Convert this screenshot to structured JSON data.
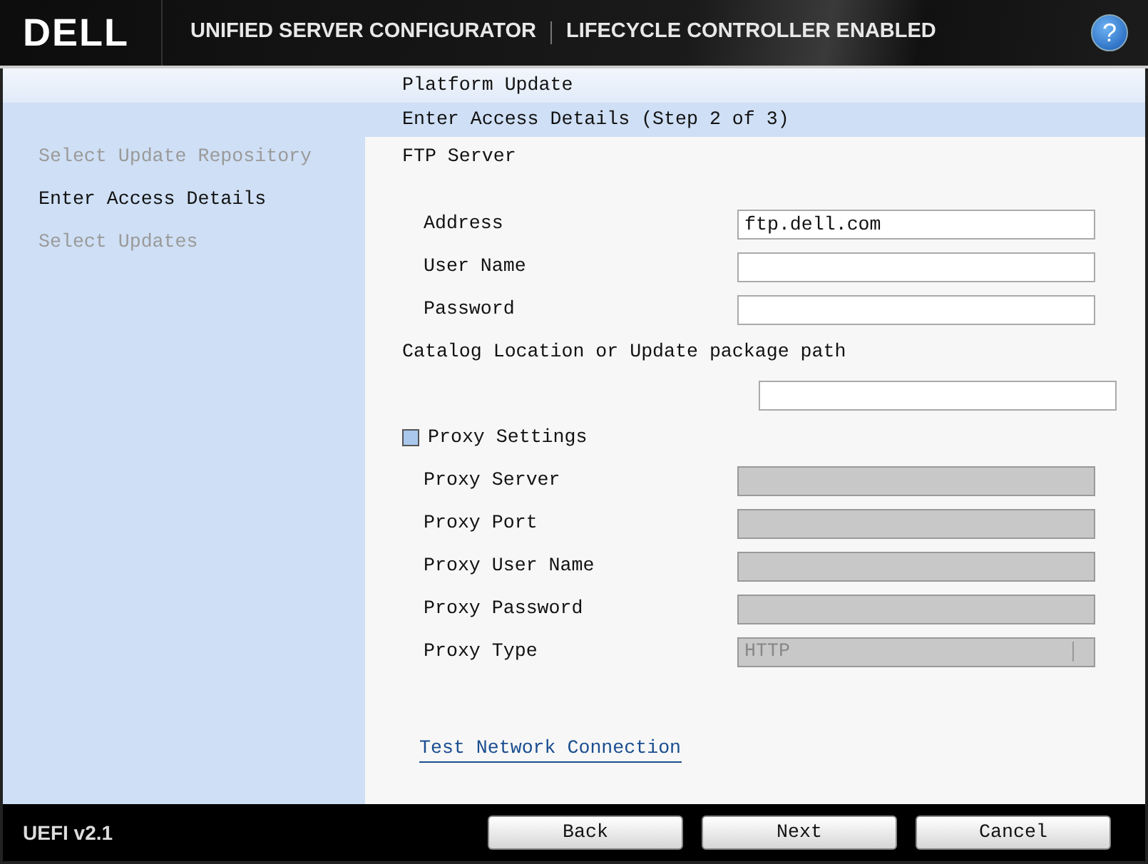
{
  "header": {
    "logo": "DELL",
    "title": "UNIFIED SERVER CONFIGURATOR",
    "subtitle": "LIFECYCLE CONTROLLER ENABLED",
    "help": "?"
  },
  "page_title": "Platform Update",
  "step_title": "Enter Access Details (Step 2 of 3)",
  "steps": [
    {
      "label": "Select Update Repository",
      "selected": false
    },
    {
      "label": "Enter Access Details",
      "selected": true
    },
    {
      "label": "Select Updates",
      "selected": false
    }
  ],
  "ftp_section": "FTP Server",
  "ftp_fields": [
    {
      "label": "Address",
      "value": "ftp.dell.com",
      "disabled": false
    },
    {
      "label": "User Name",
      "disabled": false
    },
    {
      "label": "Password",
      "disabled": false
    }
  ],
  "catalog": {
    "label": "Catalog Location or Update package path",
    "disabled": false
  },
  "proxy": {
    "label": "Proxy Settings",
    "checked": false
  },
  "proxy_fields": [
    {
      "label": "Proxy Server",
      "kind": "text",
      "disabled": true
    },
    {
      "label": "Proxy Port",
      "kind": "text",
      "disabled": true
    },
    {
      "label": "Proxy User Name",
      "kind": "text",
      "disabled": true
    },
    {
      "label": "Proxy Password",
      "kind": "text",
      "disabled": true
    },
    {
      "label": "Proxy Type",
      "kind": "select",
      "value": "HTTP",
      "disabled": true
    }
  ],
  "test_link": "Test Network Connection",
  "footer": {
    "version": "UEFI v2.1",
    "buttons": [
      "Back",
      "Next",
      "Cancel"
    ]
  }
}
